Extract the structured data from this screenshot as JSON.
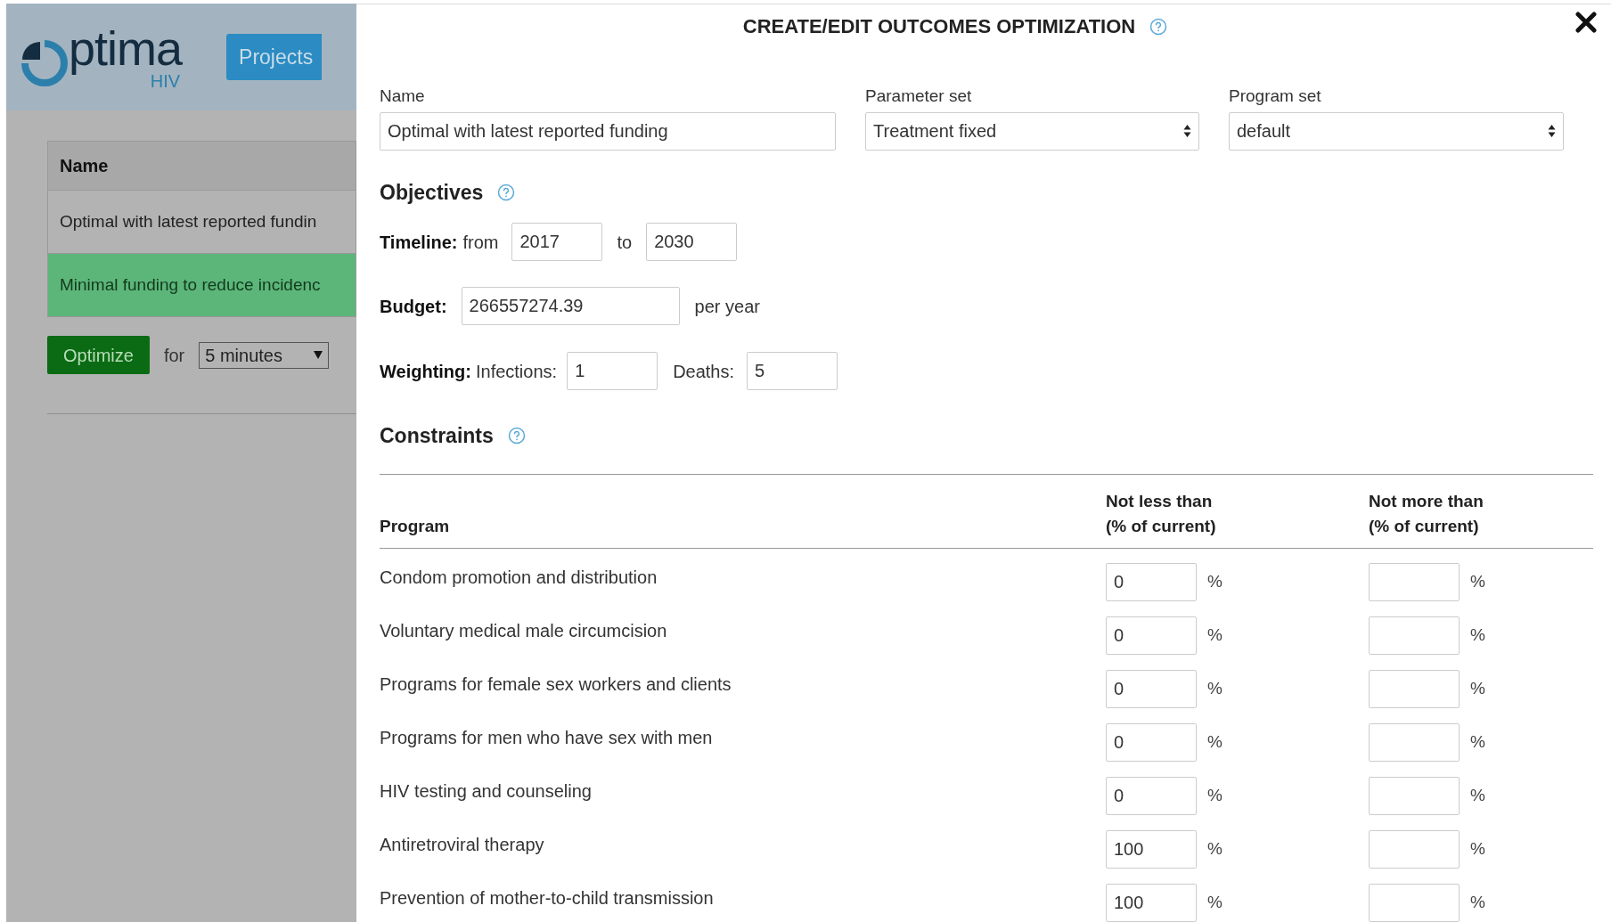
{
  "background": {
    "logo_text": "ptima",
    "logo_sub": "HIV",
    "nav_button": "Projects",
    "table": {
      "column": "Name",
      "rows": [
        {
          "name": "Optimal with latest reported fundin",
          "selected": false
        },
        {
          "name": "Minimal funding to reduce incidenc",
          "selected": true
        }
      ]
    },
    "optimize_button": "Optimize",
    "for_label": "for",
    "duration": "5 minutes"
  },
  "dialog": {
    "title": "CREATE/EDIT OUTCOMES OPTIMIZATION",
    "fields": [
      {
        "label": "Name",
        "value": "Optimal with latest reported funding",
        "kind": "text"
      },
      {
        "label": "Parameter set",
        "value": "Treatment fixed",
        "kind": "select"
      },
      {
        "label": "Program set",
        "value": "default",
        "kind": "select"
      }
    ],
    "objectives": {
      "heading": "Objectives",
      "timeline": {
        "label": "Timeline:",
        "from_label": "from",
        "from": "2017",
        "to_label": "to",
        "to": "2030"
      },
      "budget": {
        "label": "Budget:",
        "value": "266557274.39",
        "unit": "per year"
      },
      "weighting": {
        "label": "Weighting:",
        "infections_label": "Infections:",
        "infections": "1",
        "deaths_label": "Deaths:",
        "deaths": "5"
      }
    },
    "constraints": {
      "heading": "Constraints",
      "columns": [
        "Program",
        "Not less than\n(% of current)",
        "Not more than\n(% of current)"
      ],
      "rows": [
        {
          "program": "Condom promotion and distribution",
          "min": "0",
          "min_unit": "%",
          "max_unit": "%"
        },
        {
          "program": "Voluntary medical male circumcision",
          "min": "0",
          "min_unit": "%",
          "max_unit": "%"
        },
        {
          "program": "Programs for female sex workers and clients",
          "min": "0",
          "min_unit": "%",
          "max_unit": "%"
        },
        {
          "program": "Programs for men who have sex with men",
          "min": "0",
          "min_unit": "%",
          "max_unit": "%"
        },
        {
          "program": "HIV testing and counseling",
          "min": "0",
          "min_unit": "%",
          "max_unit": "%"
        },
        {
          "program": "Antiretroviral therapy",
          "min": "100",
          "min_unit": "%",
          "max_unit": "%"
        },
        {
          "program": "Prevention of mother-to-child transmission",
          "min": "100",
          "min_unit": "%",
          "max_unit": "%"
        }
      ]
    }
  }
}
